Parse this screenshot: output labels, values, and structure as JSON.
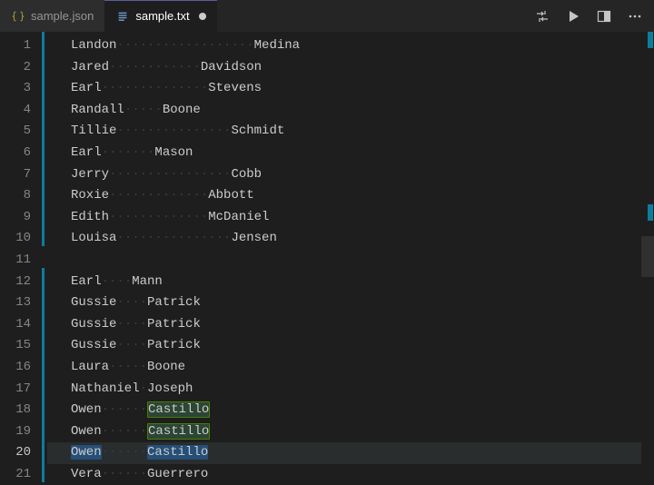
{
  "tabs": [
    {
      "label": "sample.json",
      "icon": "json-icon",
      "active": false,
      "modified": false
    },
    {
      "label": "sample.txt",
      "icon": "text-icon",
      "active": true,
      "modified": true
    }
  ],
  "actions": {
    "compare": "compare-icon",
    "run": "run-icon",
    "split": "split-icon",
    "more": "more-icon"
  },
  "editor": {
    "current_line": 20,
    "lines": [
      {
        "n": 1,
        "first": "Landon",
        "pad": 18,
        "last": "Medina",
        "hl": null
      },
      {
        "n": 2,
        "first": "Jared",
        "pad": 12,
        "last": "Davidson",
        "hl": null
      },
      {
        "n": 3,
        "first": "Earl",
        "pad": 14,
        "last": "Stevens",
        "hl": null
      },
      {
        "n": 4,
        "first": "Randall",
        "pad": 5,
        "last": "Boone",
        "hl": null
      },
      {
        "n": 5,
        "first": "Tillie",
        "pad": 15,
        "last": "Schmidt",
        "hl": null
      },
      {
        "n": 6,
        "first": "Earl",
        "pad": 7,
        "last": "Mason",
        "hl": null
      },
      {
        "n": 7,
        "first": "Jerry",
        "pad": 16,
        "last": "Cobb",
        "hl": null
      },
      {
        "n": 8,
        "first": "Roxie",
        "pad": 13,
        "last": "Abbott",
        "hl": null
      },
      {
        "n": 9,
        "first": "Edith",
        "pad": 13,
        "last": "McDaniel",
        "hl": null
      },
      {
        "n": 10,
        "first": "Louisa",
        "pad": 15,
        "last": "Jensen",
        "hl": null
      },
      {
        "n": 11,
        "first": "",
        "pad": 0,
        "last": "",
        "hl": null
      },
      {
        "n": 12,
        "first": "Earl",
        "pad": 4,
        "last": "Mann",
        "hl": null
      },
      {
        "n": 13,
        "first": "Gussie",
        "pad": 4,
        "last": "Patrick",
        "hl": null
      },
      {
        "n": 14,
        "first": "Gussie",
        "pad": 4,
        "last": "Patrick",
        "hl": null
      },
      {
        "n": 15,
        "first": "Gussie",
        "pad": 4,
        "last": "Patrick",
        "hl": null
      },
      {
        "n": 16,
        "first": "Laura",
        "pad": 5,
        "last": "Boone",
        "hl": null
      },
      {
        "n": 17,
        "first": "Nathaniel",
        "pad": 1,
        "last": "Joseph",
        "hl": null
      },
      {
        "n": 18,
        "first": "Owen",
        "pad": 6,
        "last": "Castillo",
        "hl": "soft"
      },
      {
        "n": 19,
        "first": "Owen",
        "pad": 6,
        "last": "Castillo",
        "hl": "soft"
      },
      {
        "n": 20,
        "first": "Owen",
        "pad": 6,
        "last": "Castillo",
        "hl": "strong"
      },
      {
        "n": 21,
        "first": "Vera",
        "pad": 6,
        "last": "Guerrero",
        "hl": null
      }
    ]
  },
  "colors": {
    "background": "#1e1e1e",
    "tabbar": "#252526",
    "selection": "#264f78",
    "diff_add": "#0c7d9d",
    "whitespace": "#3b3b3b",
    "line_number": "#858585"
  }
}
